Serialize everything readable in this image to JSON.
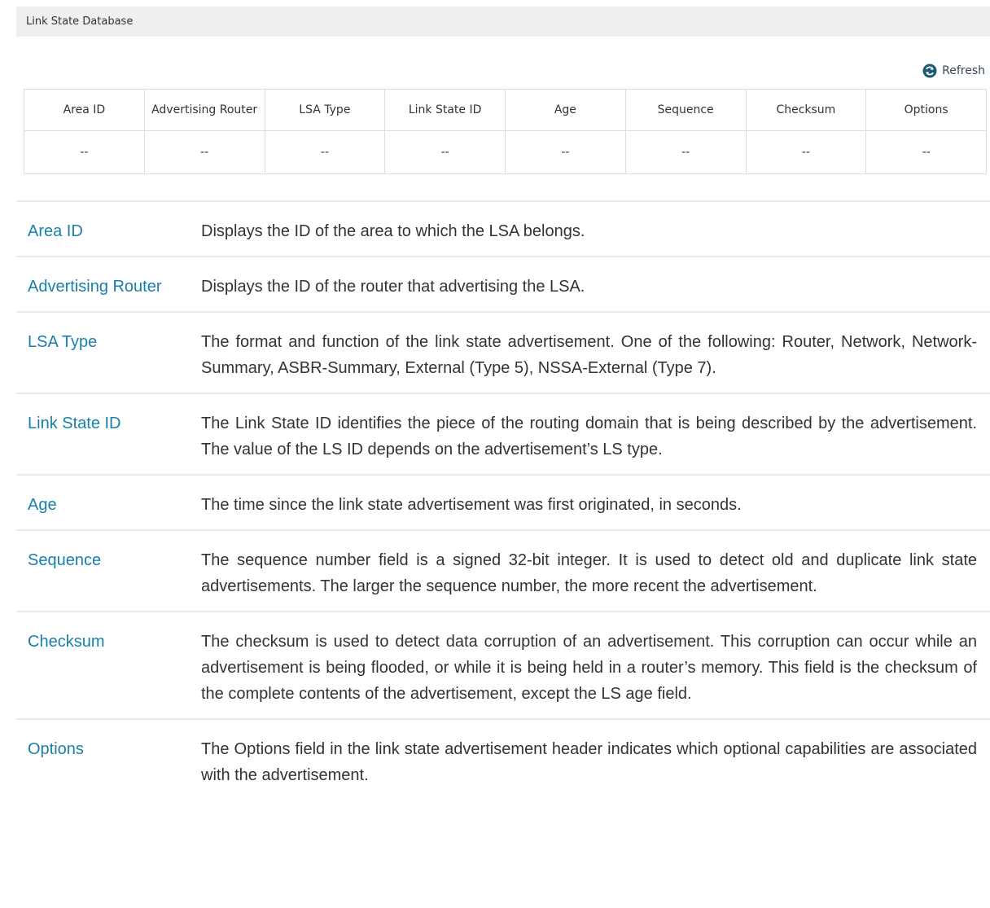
{
  "panel": {
    "title": "Link State Database",
    "refresh_label": "Refresh",
    "refresh_icon": "refresh-icon"
  },
  "table": {
    "columns": [
      "Area ID",
      "Advertising Router",
      "LSA Type",
      "Link State ID",
      "Age",
      "Sequence",
      "Checksum",
      "Options"
    ],
    "rows": [
      [
        "--",
        "--",
        "--",
        "--",
        "--",
        "--",
        "--",
        "--"
      ]
    ]
  },
  "descriptions": [
    {
      "term": "Area ID",
      "text": "Displays the ID of the area to which the LSA belongs."
    },
    {
      "term": "Advertising Router",
      "text": "Displays the ID of the router that advertising the LSA."
    },
    {
      "term": "LSA Type",
      "text": "The format and function of the link state advertisement. One of the following: Router, Network, Network-Summary, ASBR-Summary, External (Type 5), NSSA-External (Type 7)."
    },
    {
      "term": "Link State ID",
      "text": "The Link State ID identifies the piece of the routing domain that is being described by the advertisement. The value of the LS ID depends on the advertisement’s LS type."
    },
    {
      "term": "Age",
      "text": "The time since the link state advertisement was first originated, in seconds."
    },
    {
      "term": "Sequence",
      "text": "The sequence number field is a signed 32-bit integer. It is used to detect old and duplicate link state advertisements. The larger the sequence number, the more recent the advertisement."
    },
    {
      "term": "Checksum",
      "text": "The checksum is used to detect data corruption of an advertisement. This corruption can occur while an advertisement is being flooded, or while it is being held in a router’s memory. This field is the checksum of the complete contents of the advertisement, except the LS age field."
    },
    {
      "term": "Options",
      "text": "The Options field in the link state advertisement header indicates which optional capabilities are associated with the advertisement."
    }
  ],
  "colors": {
    "panel_header_bg": "#efefef",
    "term_color": "#1a7fa8",
    "divider": "#e6ebf0"
  }
}
